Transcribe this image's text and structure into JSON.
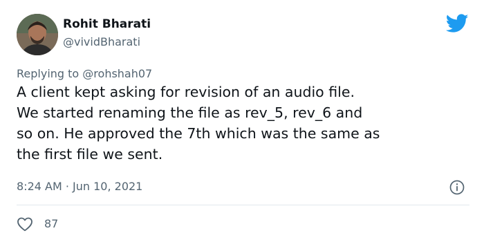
{
  "author": {
    "display_name": "Rohit Bharati",
    "handle": "@vividBharati",
    "avatar_icon": "profile-photo"
  },
  "tweet": {
    "replying_prefix": "Replying to",
    "replying_to": "@rohshah07",
    "lines": [
      "A client kept asking for revision of an audio file.",
      "We started renaming the file as rev_5, rev_6 and",
      "so on. He approved the 7th which was the same as",
      "the first file we sent."
    ],
    "timestamp": "8:24 AM · Jun 10, 2021"
  },
  "engagement": {
    "like_count": "87"
  },
  "icons": {
    "brand": "twitter-bird-icon",
    "info": "info-icon",
    "like": "heart-icon"
  },
  "colors": {
    "brand_blue": "#1d9bf0",
    "secondary_text": "#536471",
    "primary_text": "#0f1419",
    "divider": "#e1e8ed"
  }
}
